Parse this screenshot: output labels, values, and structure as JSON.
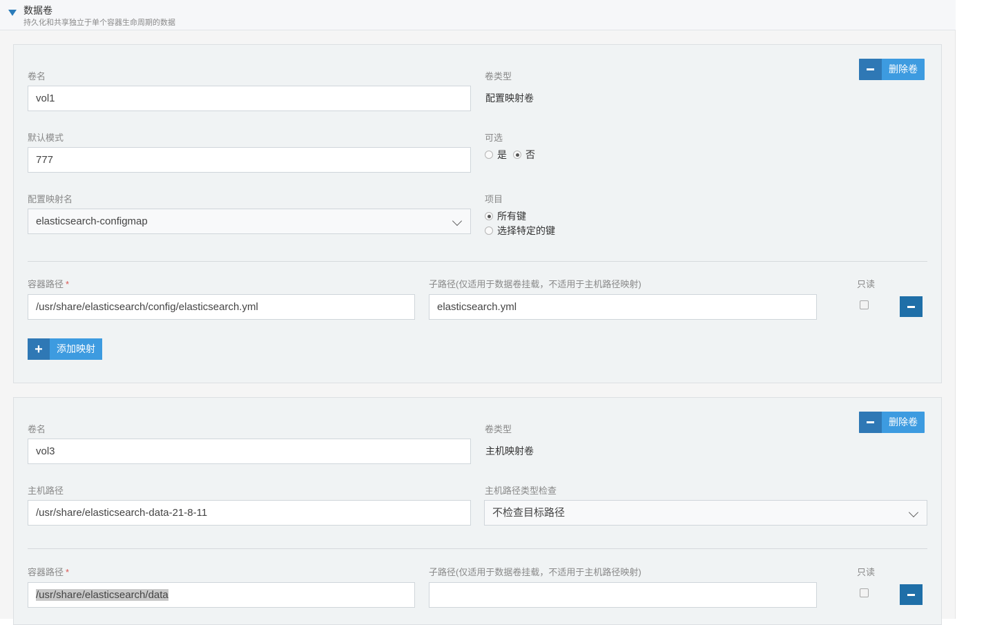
{
  "section": {
    "title": "数据卷",
    "subtitle": "持久化和共享独立于单个容器生命周期的数据"
  },
  "labels": {
    "volume_name": "卷名",
    "volume_type": "卷类型",
    "default_mode": "默认模式",
    "optional": "可选",
    "yes": "是",
    "no": "否",
    "configmap_name": "配置映射名",
    "items": "项目",
    "all_keys": "所有键",
    "specific_keys": "选择特定的键",
    "container_path": "容器路径",
    "required_mark": "*",
    "sub_path": "子路径(仅适用于数据卷挂载，不适用于主机路径映射)",
    "readonly": "只读",
    "delete_volume": "删除卷",
    "add_mapping": "添加映射",
    "host_path": "主机路径",
    "host_path_type_check": "主机路径类型检查"
  },
  "volumes": [
    {
      "name": "vol1",
      "type": "配置映射卷",
      "default_mode": "777",
      "optional": "否",
      "configmap_name": "elasticsearch-configmap",
      "items_mode": "所有键",
      "mounts": [
        {
          "container_path": "/usr/share/elasticsearch/config/elasticsearch.yml",
          "sub_path": "elasticsearch.yml",
          "readonly": false
        }
      ]
    },
    {
      "name": "vol3",
      "type": "主机映射卷",
      "host_path": "/usr/share/elasticsearch-data-21-8-11",
      "host_path_type_check": "不检查目标路径",
      "mounts": [
        {
          "container_path": "/usr/share/elasticsearch/data",
          "sub_path": "",
          "readonly": false
        }
      ]
    }
  ],
  "icons": {
    "collapse": "caret-down-icon",
    "delete": "minus-icon",
    "add": "plus-icon",
    "dropdown": "chevron-down-icon"
  },
  "colors": {
    "primary": "#3d9be0",
    "primary_dark": "#2f78b5",
    "required": "#d9534f"
  }
}
